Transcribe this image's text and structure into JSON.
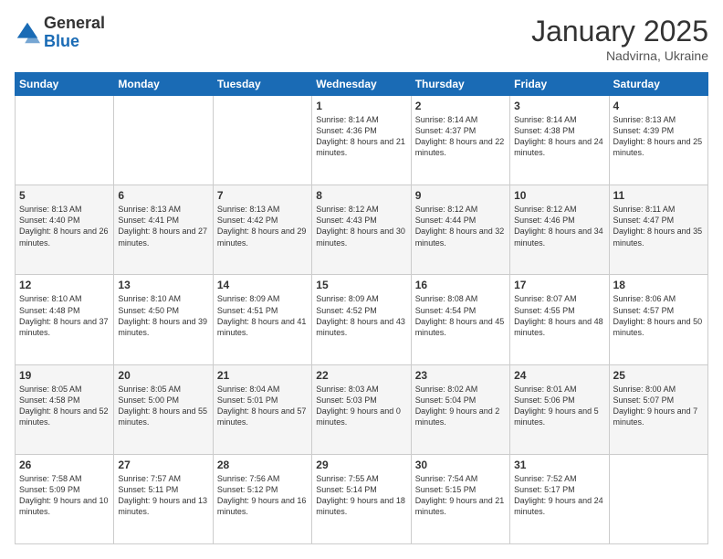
{
  "logo": {
    "general": "General",
    "blue": "Blue"
  },
  "header": {
    "month": "January 2025",
    "location": "Nadvirna, Ukraine"
  },
  "weekdays": [
    "Sunday",
    "Monday",
    "Tuesday",
    "Wednesday",
    "Thursday",
    "Friday",
    "Saturday"
  ],
  "weeks": [
    [
      {
        "day": "",
        "content": ""
      },
      {
        "day": "",
        "content": ""
      },
      {
        "day": "",
        "content": ""
      },
      {
        "day": "1",
        "content": "Sunrise: 8:14 AM\nSunset: 4:36 PM\nDaylight: 8 hours and 21 minutes."
      },
      {
        "day": "2",
        "content": "Sunrise: 8:14 AM\nSunset: 4:37 PM\nDaylight: 8 hours and 22 minutes."
      },
      {
        "day": "3",
        "content": "Sunrise: 8:14 AM\nSunset: 4:38 PM\nDaylight: 8 hours and 24 minutes."
      },
      {
        "day": "4",
        "content": "Sunrise: 8:13 AM\nSunset: 4:39 PM\nDaylight: 8 hours and 25 minutes."
      }
    ],
    [
      {
        "day": "5",
        "content": "Sunrise: 8:13 AM\nSunset: 4:40 PM\nDaylight: 8 hours and 26 minutes."
      },
      {
        "day": "6",
        "content": "Sunrise: 8:13 AM\nSunset: 4:41 PM\nDaylight: 8 hours and 27 minutes."
      },
      {
        "day": "7",
        "content": "Sunrise: 8:13 AM\nSunset: 4:42 PM\nDaylight: 8 hours and 29 minutes."
      },
      {
        "day": "8",
        "content": "Sunrise: 8:12 AM\nSunset: 4:43 PM\nDaylight: 8 hours and 30 minutes."
      },
      {
        "day": "9",
        "content": "Sunrise: 8:12 AM\nSunset: 4:44 PM\nDaylight: 8 hours and 32 minutes."
      },
      {
        "day": "10",
        "content": "Sunrise: 8:12 AM\nSunset: 4:46 PM\nDaylight: 8 hours and 34 minutes."
      },
      {
        "day": "11",
        "content": "Sunrise: 8:11 AM\nSunset: 4:47 PM\nDaylight: 8 hours and 35 minutes."
      }
    ],
    [
      {
        "day": "12",
        "content": "Sunrise: 8:10 AM\nSunset: 4:48 PM\nDaylight: 8 hours and 37 minutes."
      },
      {
        "day": "13",
        "content": "Sunrise: 8:10 AM\nSunset: 4:50 PM\nDaylight: 8 hours and 39 minutes."
      },
      {
        "day": "14",
        "content": "Sunrise: 8:09 AM\nSunset: 4:51 PM\nDaylight: 8 hours and 41 minutes."
      },
      {
        "day": "15",
        "content": "Sunrise: 8:09 AM\nSunset: 4:52 PM\nDaylight: 8 hours and 43 minutes."
      },
      {
        "day": "16",
        "content": "Sunrise: 8:08 AM\nSunset: 4:54 PM\nDaylight: 8 hours and 45 minutes."
      },
      {
        "day": "17",
        "content": "Sunrise: 8:07 AM\nSunset: 4:55 PM\nDaylight: 8 hours and 48 minutes."
      },
      {
        "day": "18",
        "content": "Sunrise: 8:06 AM\nSunset: 4:57 PM\nDaylight: 8 hours and 50 minutes."
      }
    ],
    [
      {
        "day": "19",
        "content": "Sunrise: 8:05 AM\nSunset: 4:58 PM\nDaylight: 8 hours and 52 minutes."
      },
      {
        "day": "20",
        "content": "Sunrise: 8:05 AM\nSunset: 5:00 PM\nDaylight: 8 hours and 55 minutes."
      },
      {
        "day": "21",
        "content": "Sunrise: 8:04 AM\nSunset: 5:01 PM\nDaylight: 8 hours and 57 minutes."
      },
      {
        "day": "22",
        "content": "Sunrise: 8:03 AM\nSunset: 5:03 PM\nDaylight: 9 hours and 0 minutes."
      },
      {
        "day": "23",
        "content": "Sunrise: 8:02 AM\nSunset: 5:04 PM\nDaylight: 9 hours and 2 minutes."
      },
      {
        "day": "24",
        "content": "Sunrise: 8:01 AM\nSunset: 5:06 PM\nDaylight: 9 hours and 5 minutes."
      },
      {
        "day": "25",
        "content": "Sunrise: 8:00 AM\nSunset: 5:07 PM\nDaylight: 9 hours and 7 minutes."
      }
    ],
    [
      {
        "day": "26",
        "content": "Sunrise: 7:58 AM\nSunset: 5:09 PM\nDaylight: 9 hours and 10 minutes."
      },
      {
        "day": "27",
        "content": "Sunrise: 7:57 AM\nSunset: 5:11 PM\nDaylight: 9 hours and 13 minutes."
      },
      {
        "day": "28",
        "content": "Sunrise: 7:56 AM\nSunset: 5:12 PM\nDaylight: 9 hours and 16 minutes."
      },
      {
        "day": "29",
        "content": "Sunrise: 7:55 AM\nSunset: 5:14 PM\nDaylight: 9 hours and 18 minutes."
      },
      {
        "day": "30",
        "content": "Sunrise: 7:54 AM\nSunset: 5:15 PM\nDaylight: 9 hours and 21 minutes."
      },
      {
        "day": "31",
        "content": "Sunrise: 7:52 AM\nSunset: 5:17 PM\nDaylight: 9 hours and 24 minutes."
      },
      {
        "day": "",
        "content": ""
      }
    ]
  ]
}
